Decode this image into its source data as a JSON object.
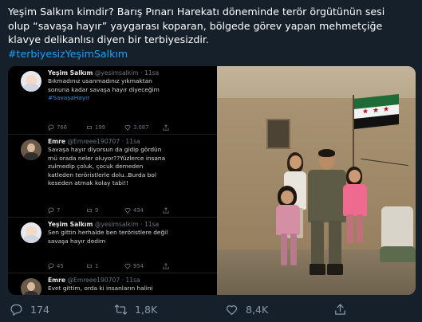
{
  "tweet": {
    "line1": "Yeşim Salkım kimdir? Barış Pınarı Harekatı döneminde terör örgütünün sesi",
    "line2": "olup “savaşa hayır” yaygarası koparan, bölgede görev yapan mehmetçiğe",
    "line3": "klavye delikanlısı diyen bir terbiyesizdir.",
    "hashtag": "#terbiyesizYeşimSalkım"
  },
  "embedded": {
    "tweets": [
      {
        "name": "Yeşim Salkım",
        "handle": "@yesimsalkim · 11sa",
        "avatar_icon": "baby-avatar",
        "lines": [
          "Bıkmadınız usanmadınız yıkmaktan",
          "sonuna kadar savaşa hayır diyeceğim"
        ],
        "tag": "#SavaşaHayır",
        "replies": "766",
        "retweets": "199",
        "likes": "3.087"
      },
      {
        "name": "Emre",
        "handle": "@Emreee190707 · 11sa",
        "avatar_icon": "man-avatar",
        "lines": [
          "Savaşa hayır diyorsun da gidip gördün",
          "mü orada neler oluyor??Yüzlerce insana",
          "zulmedip çoluk, çocuk demeden",
          "katleden teröristlerle dolu..Burda bol",
          "keseden atmak kolay tabi!!"
        ],
        "replies": "7",
        "retweets": "9",
        "likes": "434"
      },
      {
        "name": "Yeşim Salkım",
        "handle": "@yesimsalkim · 11sa",
        "avatar_icon": "baby-avatar",
        "lines": [
          "Sen gittin herhalde ben teröristlere değil",
          "savaşa hayır dedim"
        ],
        "replies": "45",
        "retweets": "1",
        "likes": "954"
      },
      {
        "name": "Emre",
        "handle": "@Emreee190707 · 11sa",
        "avatar_icon": "man-avatar",
        "lines": [
          "Evet gittim, orda ki insanların halini"
        ]
      }
    ]
  },
  "actions": {
    "replies": "174",
    "retweets": "1,8K",
    "likes": "8,4K"
  },
  "colors": {
    "background": "#15202b",
    "link": "#1da1f2",
    "muted": "#8899a6"
  }
}
